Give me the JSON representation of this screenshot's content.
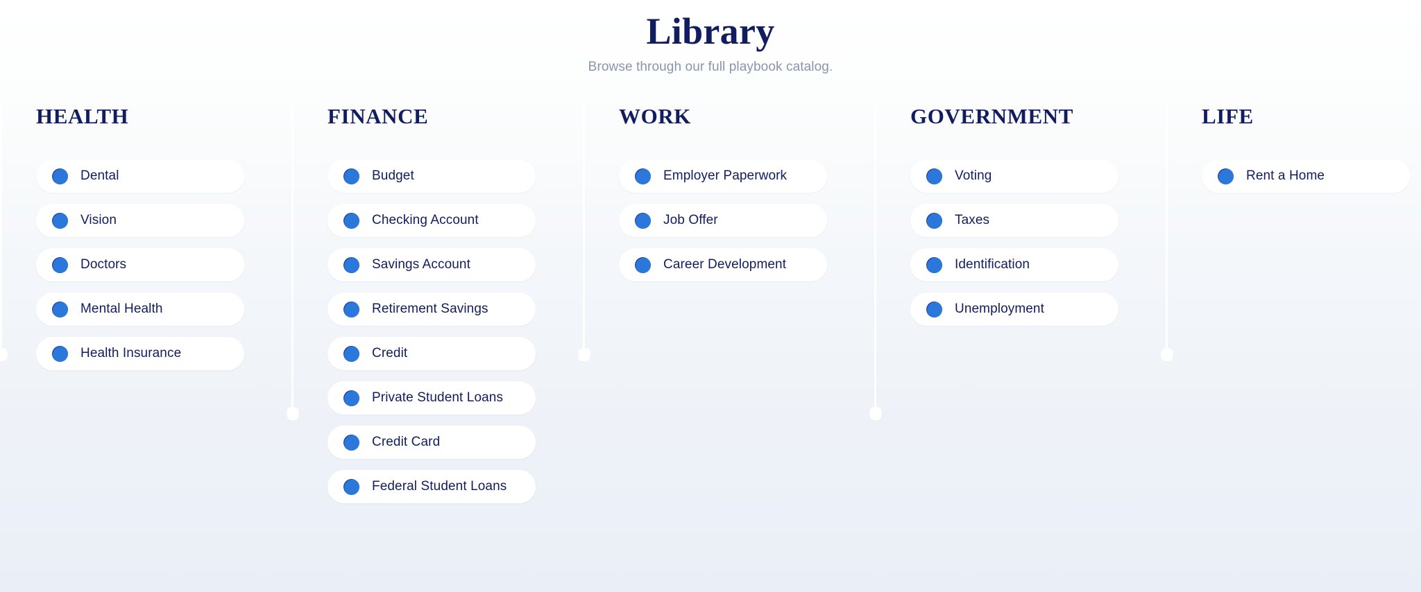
{
  "header": {
    "title": "Library",
    "subtitle": "Browse through our full playbook catalog."
  },
  "colors": {
    "navy": "#111d5e",
    "subtitle_gray": "#8b93ae",
    "icon_dark_blue": "#14349e",
    "icon_light_blue": "#2f7ee0",
    "pill_background": "#ffffff",
    "divider": "#ffffff",
    "page_background_top": "#ffffff",
    "page_background_bottom": "#eaeff7"
  },
  "icon_name": "overlapping-circles-icon",
  "columns": [
    {
      "key": "health",
      "title": "HEALTH",
      "items": [
        {
          "label": "Dental"
        },
        {
          "label": "Vision"
        },
        {
          "label": "Doctors"
        },
        {
          "label": "Mental Health"
        },
        {
          "label": "Health Insurance"
        }
      ]
    },
    {
      "key": "finance",
      "title": "FINANCE",
      "items": [
        {
          "label": "Budget"
        },
        {
          "label": "Checking Account"
        },
        {
          "label": "Savings Account"
        },
        {
          "label": "Retirement Savings"
        },
        {
          "label": "Credit"
        },
        {
          "label": "Private Student Loans"
        },
        {
          "label": "Credit Card"
        },
        {
          "label": "Federal Student Loans"
        }
      ]
    },
    {
      "key": "work",
      "title": "WORK",
      "items": [
        {
          "label": "Employer Paperwork"
        },
        {
          "label": "Job Offer"
        },
        {
          "label": "Career Development"
        }
      ]
    },
    {
      "key": "government",
      "title": "GOVERNMENT",
      "items": [
        {
          "label": "Voting"
        },
        {
          "label": "Taxes"
        },
        {
          "label": "Identification"
        },
        {
          "label": "Unemployment"
        }
      ]
    },
    {
      "key": "life",
      "title": "LIFE",
      "items": [
        {
          "label": "Rent a Home"
        }
      ]
    }
  ]
}
